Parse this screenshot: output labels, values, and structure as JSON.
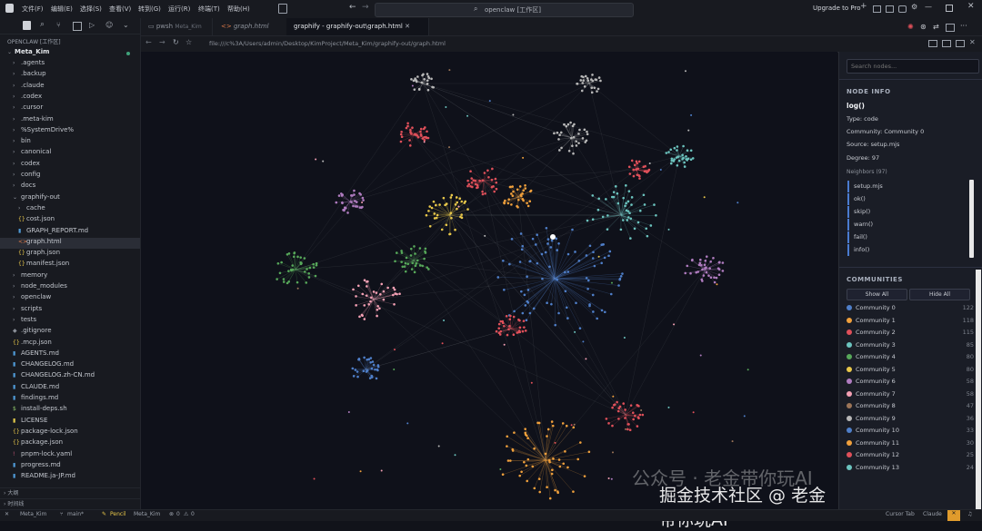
{
  "titlebar": {
    "menu": [
      "文件(F)",
      "编辑(E)",
      "选择(S)",
      "查看(V)",
      "转到(G)",
      "运行(R)",
      "终端(T)",
      "帮助(H)"
    ],
    "search": "openclaw [工作区]",
    "upgrade": "Upgrade to Pro"
  },
  "explorer": {
    "workspace": "OPENCLAW [工作区]",
    "root": "Meta_Kim",
    "items": [
      {
        "label": ".agents",
        "type": "folder",
        "depth": 1
      },
      {
        "label": ".backup",
        "type": "folder",
        "depth": 1
      },
      {
        "label": ".claude",
        "type": "folder",
        "depth": 1
      },
      {
        "label": ".codex",
        "type": "folder",
        "depth": 1
      },
      {
        "label": ".cursor",
        "type": "folder",
        "depth": 1
      },
      {
        "label": ".meta-kim",
        "type": "folder",
        "depth": 1
      },
      {
        "label": "%SystemDrive%",
        "type": "folder",
        "depth": 1
      },
      {
        "label": "bin",
        "type": "folder",
        "depth": 1
      },
      {
        "label": "canonical",
        "type": "folder",
        "depth": 1
      },
      {
        "label": "codex",
        "type": "folder",
        "depth": 1
      },
      {
        "label": "config",
        "type": "folder",
        "depth": 1
      },
      {
        "label": "docs",
        "type": "folder",
        "depth": 1
      },
      {
        "label": "graphify-out",
        "type": "folder-open",
        "depth": 1
      },
      {
        "label": "cache",
        "type": "folder",
        "depth": 2
      },
      {
        "label": "cost.json",
        "type": "json",
        "depth": 2
      },
      {
        "label": "GRAPH_REPORT.md",
        "type": "md",
        "depth": 2
      },
      {
        "label": "graph.html",
        "type": "html",
        "depth": 2,
        "selected": true
      },
      {
        "label": "graph.json",
        "type": "json",
        "depth": 2
      },
      {
        "label": "manifest.json",
        "type": "json",
        "depth": 2
      },
      {
        "label": "memory",
        "type": "folder",
        "depth": 1
      },
      {
        "label": "node_modules",
        "type": "folder",
        "depth": 1
      },
      {
        "label": "openclaw",
        "type": "folder",
        "depth": 1
      },
      {
        "label": "scripts",
        "type": "folder",
        "depth": 1
      },
      {
        "label": "tests",
        "type": "folder",
        "depth": 1
      },
      {
        "label": ".gitignore",
        "type": "git",
        "depth": 1
      },
      {
        "label": ".mcp.json",
        "type": "json",
        "depth": 1
      },
      {
        "label": "AGENTS.md",
        "type": "md",
        "depth": 1
      },
      {
        "label": "CHANGELOG.md",
        "type": "md",
        "depth": 1
      },
      {
        "label": "CHANGELOG.zh-CN.md",
        "type": "md",
        "depth": 1
      },
      {
        "label": "CLAUDE.md",
        "type": "md",
        "depth": 1
      },
      {
        "label": "findings.md",
        "type": "md",
        "depth": 1
      },
      {
        "label": "install-deps.sh",
        "type": "sh",
        "depth": 1
      },
      {
        "label": "LICENSE",
        "type": "lic",
        "depth": 1
      },
      {
        "label": "package-lock.json",
        "type": "json",
        "depth": 1
      },
      {
        "label": "package.json",
        "type": "json",
        "depth": 1
      },
      {
        "label": "pnpm-lock.yaml",
        "type": "yaml",
        "depth": 1
      },
      {
        "label": "progress.md",
        "type": "md",
        "depth": 1
      },
      {
        "label": "README.ja-JP.md",
        "type": "md",
        "depth": 1
      }
    ],
    "outline": "大纲",
    "timeline": "时间线"
  },
  "tabs": [
    {
      "label": "pwsh",
      "sub": "Meta_Kim"
    },
    {
      "label": "graph.html",
      "sub": ""
    },
    {
      "label": "graphify - graphify-out\\graph.html",
      "sub": ""
    }
  ],
  "url": "file:///c%3A/Users/admin/Desktop/KimProject/Meta_Kim/graphify-out/graph.html",
  "panel": {
    "search_placeholder": "Search nodes...",
    "node_info_title": "NODE INFO",
    "node_name": "log()",
    "type": "Type: code",
    "community": "Community: Community 0",
    "source": "Source: setup.mjs",
    "degree": "Degree: 97",
    "neighbors_label": "Neighbors (97)",
    "neighbors": [
      "setup.mjs",
      "ok()",
      "skip()",
      "warn()",
      "fail()",
      "info()"
    ],
    "communities_title": "COMMUNITIES",
    "show_all": "Show All",
    "hide_all": "Hide All",
    "communities": [
      {
        "name": "Community 0",
        "count": "122",
        "color": "#4f7fc9"
      },
      {
        "name": "Community 1",
        "count": "118",
        "color": "#f0a03c"
      },
      {
        "name": "Community 2",
        "count": "115",
        "color": "#e0505a"
      },
      {
        "name": "Community 3",
        "count": "85",
        "color": "#6cc4bf"
      },
      {
        "name": "Community 4",
        "count": "80",
        "color": "#57a85a"
      },
      {
        "name": "Community 5",
        "count": "80",
        "color": "#e9c84a"
      },
      {
        "name": "Community 6",
        "count": "58",
        "color": "#b07cc0"
      },
      {
        "name": "Community 7",
        "count": "58",
        "color": "#f4a0b4"
      },
      {
        "name": "Community 8",
        "count": "47",
        "color": "#9c7558"
      },
      {
        "name": "Community 9",
        "count": "36",
        "color": "#b8b8b8"
      },
      {
        "name": "Community 10",
        "count": "33",
        "color": "#4f7fc9"
      },
      {
        "name": "Community 11",
        "count": "30",
        "color": "#f0a03c"
      },
      {
        "name": "Community 12",
        "count": "25",
        "color": "#e0505a"
      },
      {
        "name": "Community 13",
        "count": "24",
        "color": "#6cc4bf"
      }
    ]
  },
  "statusbar": {
    "branch": "main*",
    "project": "Meta_Kim",
    "pencil": "Pencil",
    "meta": "Meta_Kim",
    "problems": "0",
    "warnings": "0",
    "cursor_tab": "Cursor Tab",
    "claude": "Claude"
  },
  "watermark": {
    "line1": "公众号 · 老金带你玩AI",
    "line2": "掘金技术社区 @ 老金带你玩AI"
  }
}
